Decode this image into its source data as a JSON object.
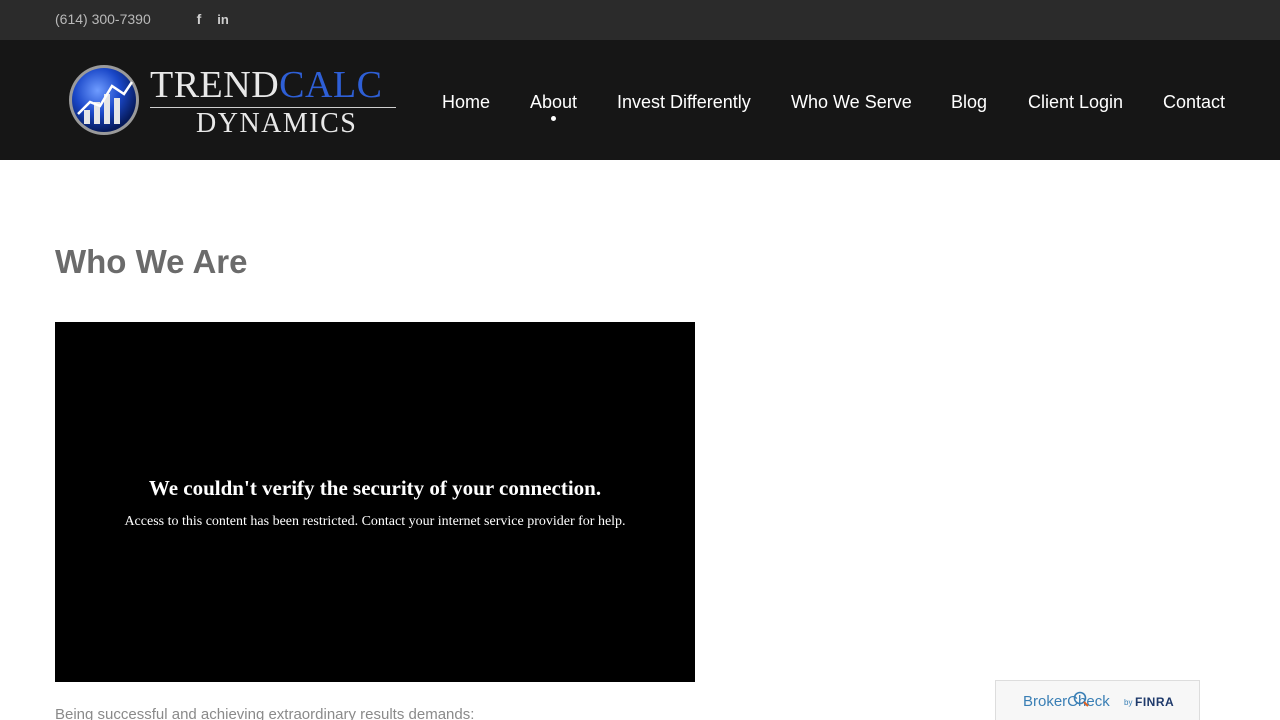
{
  "topbar": {
    "phone": "(614) 300-7390",
    "social": [
      {
        "name": "facebook-icon",
        "glyph": "f"
      },
      {
        "name": "linkedin-icon",
        "glyph": "in"
      }
    ]
  },
  "logo": {
    "word1a": "TREND",
    "word1b": "CALC",
    "word2": "DYNAMICS"
  },
  "nav": {
    "items": [
      "Home",
      "About",
      "Invest Differently",
      "Who We Serve",
      "Blog",
      "Client Login",
      "Contact"
    ],
    "active": "About"
  },
  "page": {
    "title": "Who We Are",
    "intro": "Being successful and achieving extraordinary results demands:"
  },
  "video": {
    "heading": "We couldn't verify the security of your connection.",
    "message": "Access to this content has been restricted. Contact your internet service provider for help."
  },
  "brokercheck": {
    "brand": "BrokerCheck",
    "by": "by",
    "finra": "FINRA"
  },
  "colors": {
    "topbar": "#2b2b2b",
    "header": "#161616",
    "accent_blue": "#2e5fd6",
    "title_gray": "#6b6b6b"
  }
}
